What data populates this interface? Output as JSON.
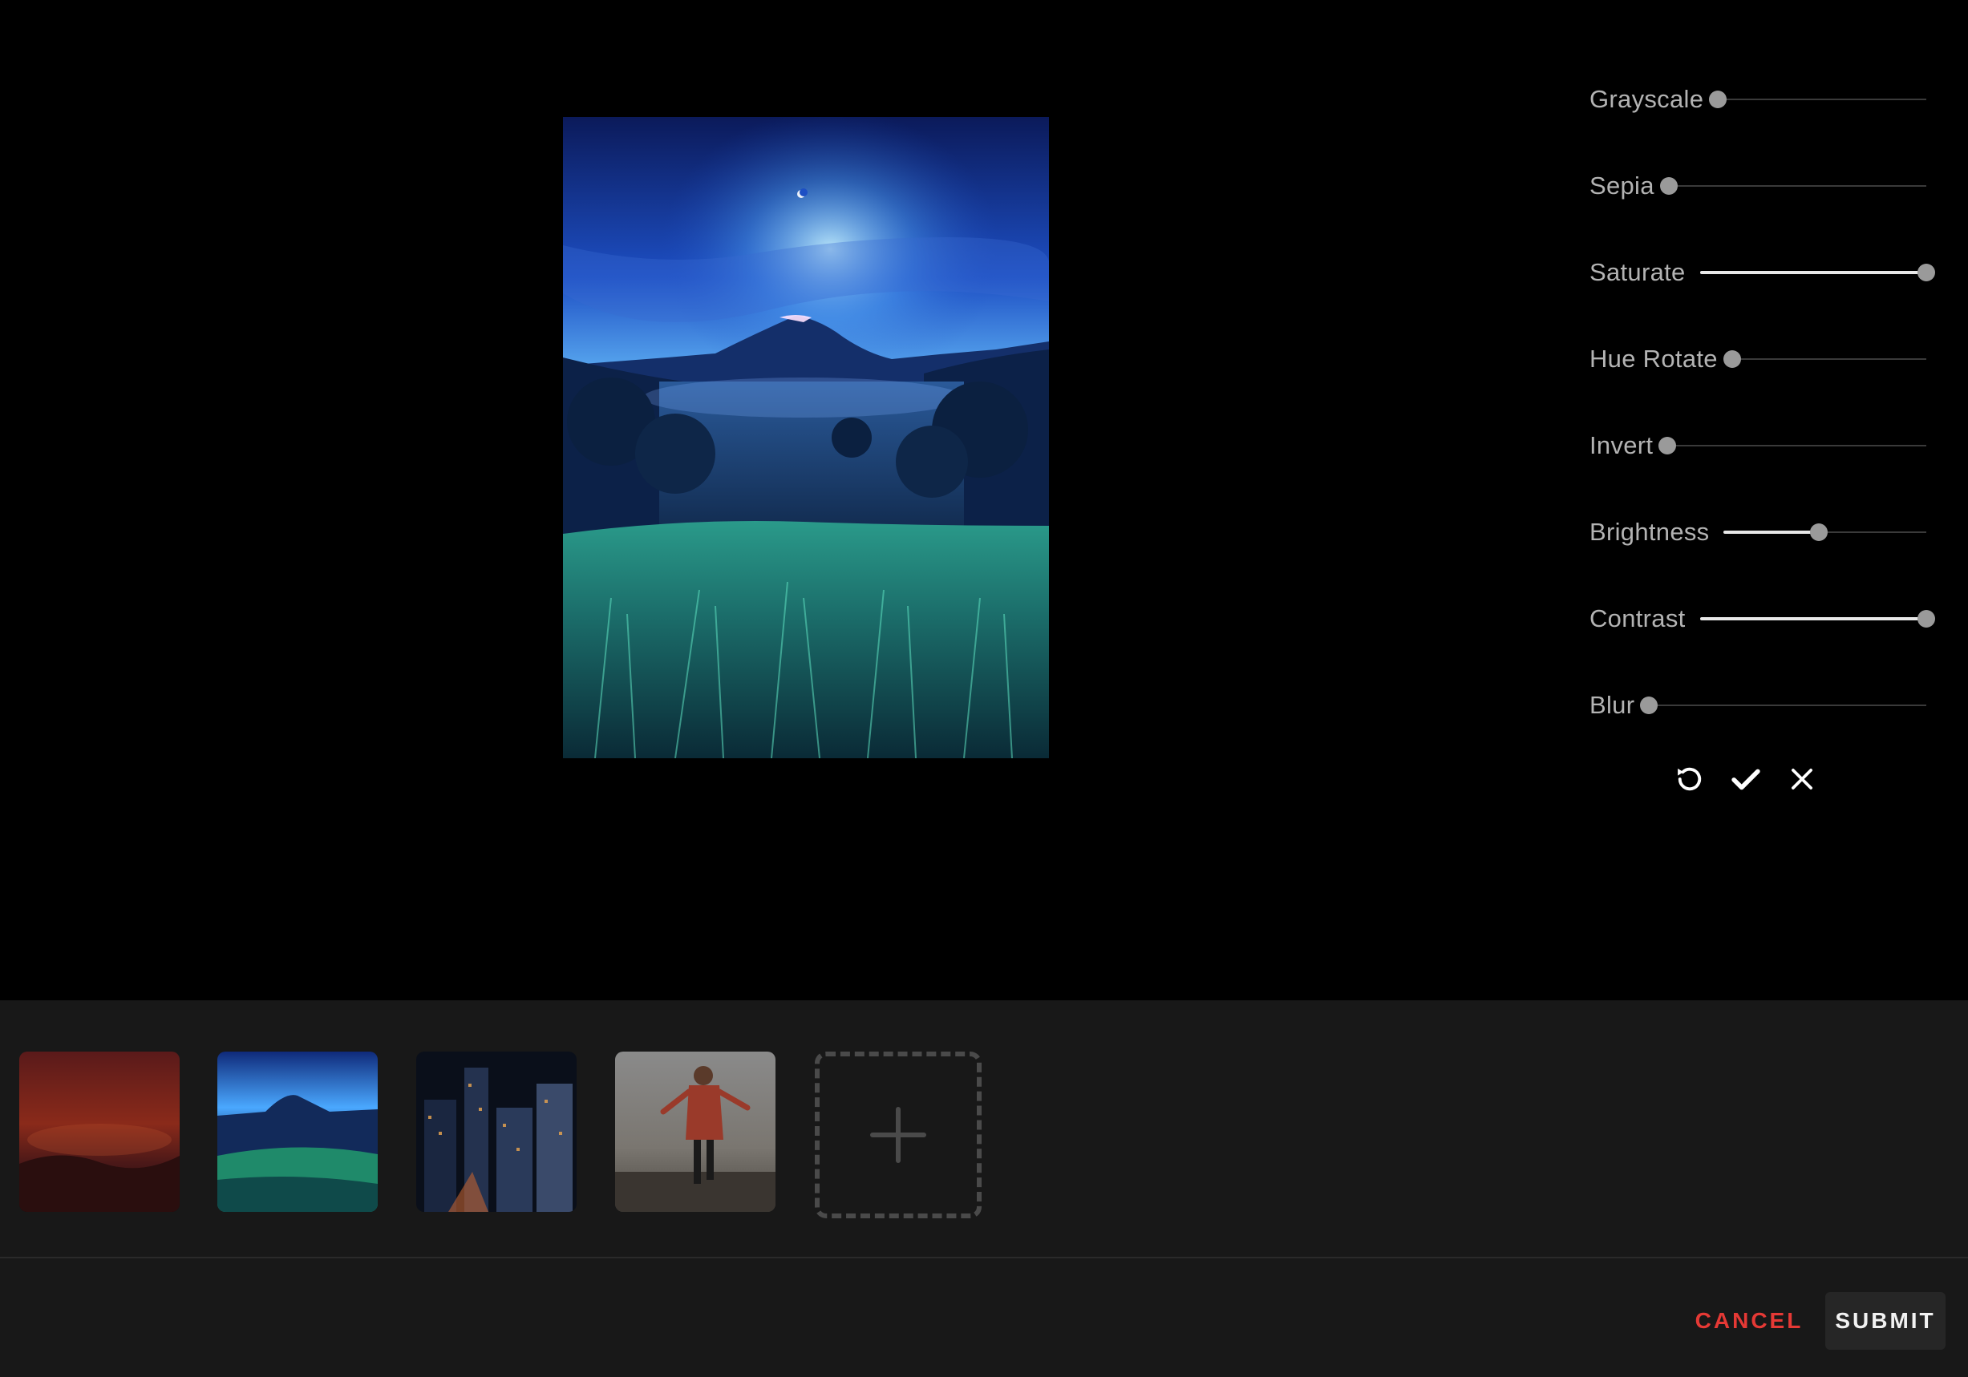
{
  "editor": {
    "filters": [
      {
        "label": "Grayscale",
        "value": 0
      },
      {
        "label": "Sepia",
        "value": 0
      },
      {
        "label": "Saturate",
        "value": 1.0
      },
      {
        "label": "Hue Rotate",
        "value": 0
      },
      {
        "label": "Invert",
        "value": 0
      },
      {
        "label": "Brightness",
        "value": 0.47
      },
      {
        "label": "Contrast",
        "value": 1.0
      },
      {
        "label": "Blur",
        "value": 0
      }
    ],
    "actions": {
      "reset_icon": "rotate-ccw-icon",
      "apply_icon": "check-icon",
      "close_icon": "close-icon"
    }
  },
  "tray": {
    "thumbnails": [
      {
        "name": "red-sunset-landscape"
      },
      {
        "name": "blue-mountain-night"
      },
      {
        "name": "city-night-skyline"
      },
      {
        "name": "person-on-beach"
      }
    ],
    "add_icon": "plus-icon"
  },
  "footer": {
    "cancel_label": "CANCEL",
    "submit_label": "SUBMIT"
  },
  "colors": {
    "background": "#000000",
    "panel": "#181818",
    "cancel": "#e53935",
    "slider_thumb": "#9a9a9a",
    "slider_fill": "#e8e8e8"
  }
}
